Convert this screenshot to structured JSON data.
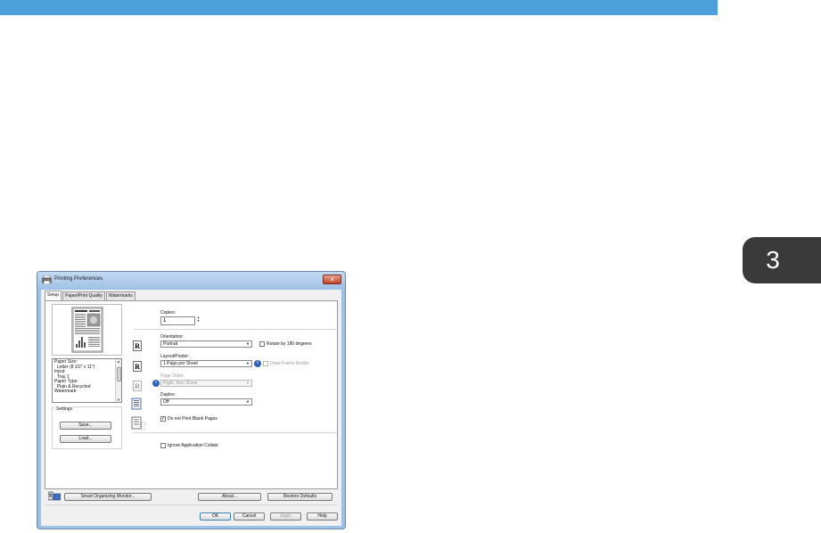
{
  "chapter": {
    "number": "3"
  },
  "window": {
    "title": "Printing Preferences",
    "close_glyph": "✕",
    "tabs": [
      {
        "label": "Setup",
        "active": true
      },
      {
        "label": "Paper/Print Quality",
        "active": false
      },
      {
        "label": "Watermarks",
        "active": false
      }
    ]
  },
  "summary": {
    "lines": [
      "Paper Size:",
      "  Letter (8 1/2\" x 11\")",
      "Input:",
      "  Tray 1",
      "Paper Type:",
      "  Plain & Recycled",
      "Watermark:"
    ]
  },
  "settings": {
    "group_label": "Settings",
    "save_label": "Save...",
    "load_label": "Load..."
  },
  "copies": {
    "label": "Copies:",
    "value": "1"
  },
  "orientation": {
    "label": "Orientation:",
    "value": "Portrait",
    "rotate_label": "Rotate by 180 degrees"
  },
  "layout": {
    "label": "Layout/Poster:",
    "value": "1 Page per Sheet",
    "frame_label": "Draw Frame Border"
  },
  "page_order": {
    "label": "Page Order:",
    "value": "Right, then Down"
  },
  "duplex": {
    "label": "Duplex:",
    "value": "Off"
  },
  "blank_pages": {
    "label": "Do not Print Blank Pages",
    "checked": true
  },
  "collate": {
    "label": "Ignore Application Collate",
    "checked": false
  },
  "icons": {
    "r_glyph": "R",
    "info_glyph": "i",
    "check_glyph": "✓",
    "arrow_glyph": "▼"
  },
  "bottom": {
    "monitor_label": "Smart Organizing Monitor...",
    "about_label": "About...",
    "restore_label": "Restore Defaults"
  },
  "footer": {
    "ok": "OK",
    "cancel": "Cancel",
    "apply": "Apply",
    "help": "Help"
  }
}
